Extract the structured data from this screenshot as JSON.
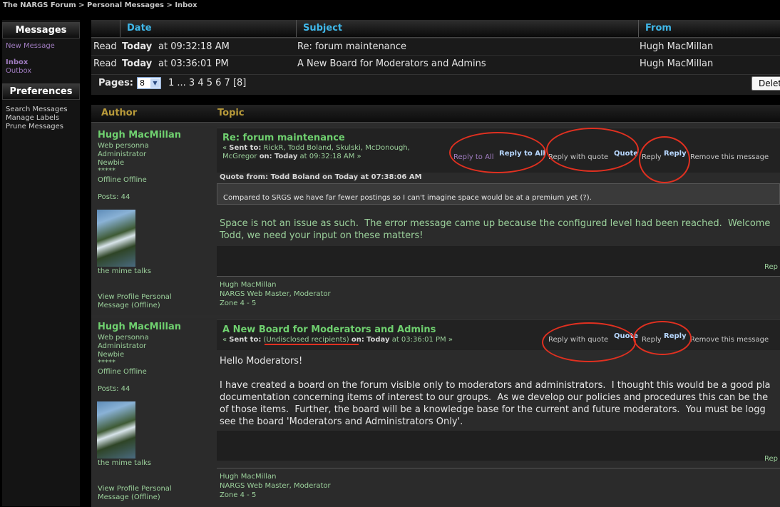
{
  "breadcrumb": {
    "forum": "The NARGS Forum",
    "sep1": ">",
    "section": "Personal Messages",
    "sep2": ">",
    "current": "Inbox"
  },
  "sidebar": {
    "messages_title": "Messages",
    "new_message": "New Message",
    "inbox": "Inbox",
    "outbox": "Outbox",
    "preferences_title": "Preferences",
    "search": "Search Messages",
    "labels": "Manage Labels",
    "prune": "Prune Messages"
  },
  "inbox": {
    "columns": {
      "date": "Date",
      "subject": "Subject",
      "from": "From"
    },
    "rows": [
      {
        "status": "Read",
        "date_day": "Today",
        "date_time": "at 09:32:18 AM",
        "subject": "Re: forum maintenance",
        "from": "Hugh MacMillan"
      },
      {
        "status": "Read",
        "date_day": "Today",
        "date_time": "at 03:36:01 PM",
        "subject": "A New Board for Moderators and Admins",
        "from": "Hugh MacMillan"
      }
    ],
    "pages_label": "Pages:",
    "page_selected": "8",
    "page_list": "1 ... 3 4 5 6 7 [8]",
    "delete_label": "Delet"
  },
  "messages_header": {
    "author": "Author",
    "topic": "Topic"
  },
  "posts": [
    {
      "author": "Hugh MacMillan",
      "title_line": "Web personna",
      "group": "Administrator",
      "rank": "Newbie",
      "stars": "*****",
      "status": "Offline Offline",
      "posts": "Posts: 44",
      "avatar_caption": "the mime talks",
      "view_links": "View Profile Personal Message (Offline)",
      "topic": "Re: forum maintenance",
      "sent_prefix": "« ",
      "sent_label": "Sent to:",
      "sent_to": " RickR, Todd Boland, Skulski, McDonough, McGregor ",
      "sent_on_label": "on:",
      "sent_day": "Today",
      "sent_time": " at 09:32:18 AM »",
      "actions": {
        "reply_all": "Reply to All",
        "reply_all_btn": "Reply to All",
        "reply_quote": "Reply with quote",
        "quote_btn": "Quote",
        "reply": "Reply",
        "reply_btn": "Reply",
        "remove": "Remove this message"
      },
      "quote_header": "Quote from: Todd Boland on Today at 07:38:06 AM",
      "quote_text": "Compared to SRGS we have far fewer postings so I can't imagine space would be at a premium yet (?).",
      "body": "Space is not an issue as such.  The error message came up because the configured level had been reached.  Welcome\nTodd, we need your input on these matters!",
      "rep_cut": "Rep",
      "sig": [
        "Hugh MacMillan",
        "NARGS Web Master, Moderator",
        "Zone 4 - 5"
      ]
    },
    {
      "author": "Hugh MacMillan",
      "title_line": "Web personna",
      "group": "Administrator",
      "rank": "Newbie",
      "stars": "*****",
      "status": "Offline Offline",
      "posts": "Posts: 44",
      "avatar_caption": "the mime talks",
      "view_links": "View Profile Personal Message (Offline)",
      "topic": "A New Board for Moderators and Admins",
      "sent_prefix": "« ",
      "sent_label": "Sent to:",
      "sent_to": "(Undisclosed recipients)",
      "sent_on_label": "on:",
      "sent_day": "Today",
      "sent_time": " at 03:36:01 PM »",
      "actions": {
        "reply_quote": "Reply with quote",
        "quote_btn": "Quote",
        "reply": "Reply",
        "reply_btn": "Reply",
        "remove": "Remove this message"
      },
      "greeting": "Hello Moderators!",
      "body": "I have created a board on the forum visible only to moderators and administrators.  I thought this would be a good pla\ndocumentation concerning items of interest to our groups.  As we develop our policies and procedures this can be the\nof those items.  Further, the board will be a knowledge base for the current and future moderators.  You must be logg\nsee the board 'Moderators and Administrators Only'.",
      "rep_cut": "Rep",
      "sig": [
        "Hugh MacMillan",
        "NARGS Web Master, Moderator",
        "Zone 4 - 5"
      ]
    }
  ],
  "colors": {
    "annotation": "#e03020",
    "link_purple": "#a07cc0",
    "header_blue": "#3fb7e8",
    "post_green": "#6fd06f"
  }
}
